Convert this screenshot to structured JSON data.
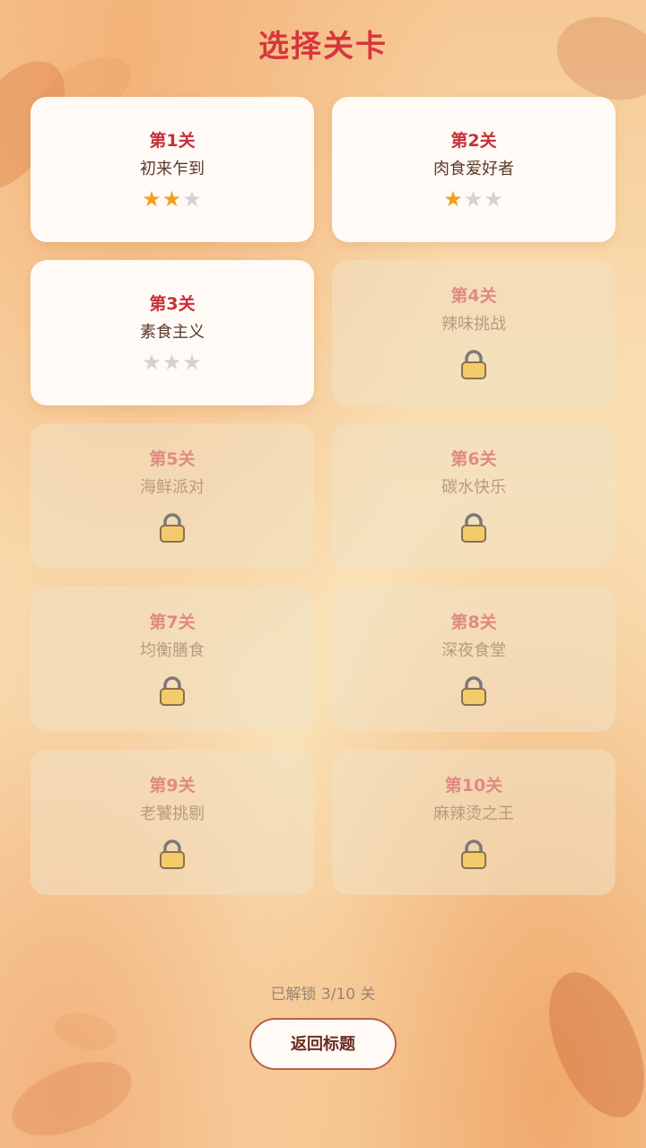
{
  "header": {
    "title": "选择关卡"
  },
  "colors": {
    "accent": "#d8363c",
    "star_on": "#f0a020",
    "star_off": "#d2d2d2",
    "lock_body": "#f2cc6a"
  },
  "levels": [
    {
      "label": "第1关",
      "name": "初来乍到",
      "locked": false,
      "stars": 2,
      "max_stars": 3
    },
    {
      "label": "第2关",
      "name": "肉食爱好者",
      "locked": false,
      "stars": 1,
      "max_stars": 3
    },
    {
      "label": "第3关",
      "name": "素食主义",
      "locked": false,
      "stars": 0,
      "max_stars": 3
    },
    {
      "label": "第4关",
      "name": "辣味挑战",
      "locked": true,
      "icon": "lock-icon"
    },
    {
      "label": "第5关",
      "name": "海鲜派对",
      "locked": true,
      "icon": "lock-icon"
    },
    {
      "label": "第6关",
      "name": "碳水快乐",
      "locked": true,
      "icon": "lock-icon"
    },
    {
      "label": "第7关",
      "name": "均衡膳食",
      "locked": true,
      "icon": "lock-icon"
    },
    {
      "label": "第8关",
      "name": "深夜食堂",
      "locked": true,
      "icon": "lock-icon"
    },
    {
      "label": "第9关",
      "name": "老饕挑剔",
      "locked": true,
      "icon": "lock-icon"
    },
    {
      "label": "第10关",
      "name": "麻辣烫之王",
      "locked": true,
      "icon": "lock-icon"
    }
  ],
  "footer": {
    "unlock_status": "已解锁 3/10 关",
    "back_label": "返回标题"
  }
}
